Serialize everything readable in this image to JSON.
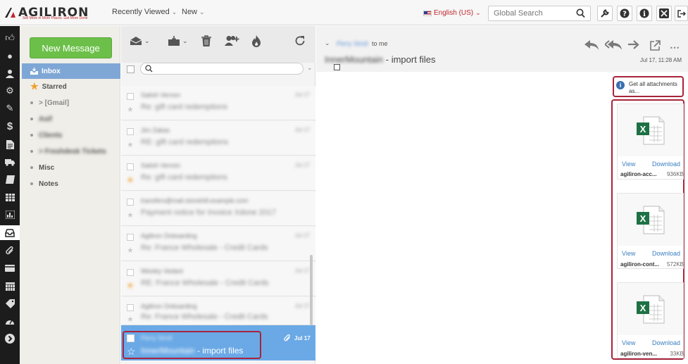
{
  "app": {
    "logo_text": "AGILIRON",
    "logo_tagline": "Sell More in More Places. Get More Done",
    "nav": [
      {
        "label": "Recently Viewed"
      },
      {
        "label": "New"
      }
    ],
    "language": "English (US)",
    "search_placeholder": "Global Search",
    "tool_icons": [
      "wrench-icon",
      "help-icon",
      "info-icon",
      "expand-icon",
      "logout-icon"
    ]
  },
  "rail_icons": [
    "thumbs-up-icon",
    "paw-icon",
    "user-icon",
    "gears-icon",
    "edit-icon",
    "dollar-icon",
    "document-icon",
    "truck-icon",
    "book-icon",
    "table-icon",
    "chart-icon",
    "inbox-icon",
    "paperclip-icon",
    "card-icon",
    "calendar-icon",
    "tag-icon",
    "dashboard-icon",
    "arrow-right-icon"
  ],
  "folders": {
    "new_message": "New Message",
    "items": [
      {
        "label": "Inbox",
        "selected": true
      },
      {
        "label": "Starred"
      },
      {
        "label": "> [Gmail]"
      },
      {
        "label": "Asif",
        "blurred": true
      },
      {
        "label": "Clients",
        "blurred": true
      },
      {
        "label": "> Freshdesk Tickets",
        "blurred": true
      },
      {
        "label": "Misc"
      },
      {
        "label": "Notes"
      }
    ]
  },
  "list": {
    "search_placeholder": "",
    "messages": [
      {
        "from": "Satish Vernon",
        "subject": "Re: gift card redemptions",
        "date": "Jul 17",
        "starred": false
      },
      {
        "from": "Jim Zakas",
        "subject": "RE: gift card redemptions",
        "date": "Jul 17",
        "starred": false
      },
      {
        "from": "Satish Vernon",
        "subject": "Re: gift card redemptions",
        "date": "Jul 17",
        "starred": true
      },
      {
        "from": "transfers@mail.stonehill.example.com",
        "subject": "Payment notice for Invoice Xdone 2017",
        "date": "Jul 17",
        "starred": false
      },
      {
        "from": "Agiliron Onboarding",
        "subject": "Re: France Wholesale - Credit Cards",
        "date": "Jul 17",
        "starred": false
      },
      {
        "from": "Wesley Vedant",
        "subject": "RE: France Wholesale - Credit Cards",
        "date": "Jul 17",
        "starred": true
      },
      {
        "from": "Agiliron Onboarding",
        "subject": "Re: France Wholesale - Credit Cards",
        "date": "Jul 17",
        "starred": false
      }
    ],
    "selected": {
      "from": "Perry Stroll",
      "subject_blur": "InnerMountain",
      "subject": "- import files",
      "date": "Jul 17"
    }
  },
  "reader": {
    "from": "Perry Stroll",
    "to": "to me",
    "subject_blur": "InnerMountain",
    "subject": "- import files",
    "date": "Jul 17, 11:28 AM",
    "get_all": "Get all attachments as...",
    "attachments": [
      {
        "name": "agiliron-acc...",
        "size": "936KB",
        "view": "View",
        "download": "Download"
      },
      {
        "name": "agiliron-cont...",
        "size": "572KB",
        "view": "View",
        "download": "Download"
      },
      {
        "name": "agiliron-ven...",
        "size": "33KB",
        "view": "View",
        "download": "Download"
      }
    ]
  }
}
